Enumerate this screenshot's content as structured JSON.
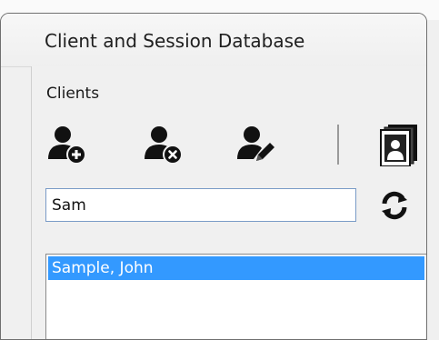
{
  "window": {
    "title": "Client and Session Database"
  },
  "clients": {
    "section_label": "Clients",
    "toolbar": {
      "add_icon": "add-client-icon",
      "remove_icon": "remove-client-icon",
      "edit_icon": "edit-client-icon",
      "report_icon": "client-report-icon"
    },
    "search": {
      "value": "Sam"
    },
    "refresh_icon": "refresh-icon",
    "list": [
      {
        "label": "Sample, John",
        "selected": true
      }
    ]
  },
  "colors": {
    "selection": "#3399ff",
    "input_border": "#7a9bc7"
  }
}
